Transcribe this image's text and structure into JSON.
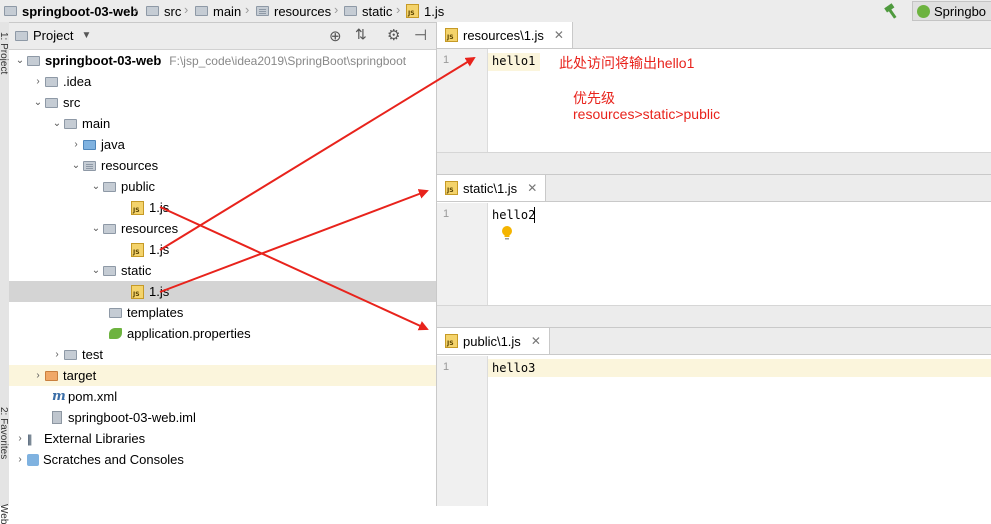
{
  "breadcrumb": {
    "items": [
      {
        "label": "springboot-03-web",
        "icon": "module-folder-icon"
      },
      {
        "label": "src",
        "icon": "folder-icon"
      },
      {
        "label": "main",
        "icon": "folder-icon"
      },
      {
        "label": "resources",
        "icon": "resources-folder-icon"
      },
      {
        "label": "static",
        "icon": "folder-icon"
      },
      {
        "label": "1.js",
        "icon": "js-file-icon"
      }
    ],
    "run_config": "Springbo",
    "build_icon": "hammer-icon"
  },
  "left_strip": {
    "project_label": "1: Project",
    "favorites_label": "2: Favorites",
    "web_label": "Web"
  },
  "project_panel": {
    "title": "Project",
    "tree": [
      {
        "label": "springboot-03-web",
        "path": "F:\\jsp_code\\idea2019\\SpringBoot\\springboot",
        "icon": "module-folder-icon"
      },
      {
        "label": ".idea",
        "icon": "folder-icon"
      },
      {
        "label": "src",
        "icon": "folder-icon"
      },
      {
        "label": "main",
        "icon": "folder-icon"
      },
      {
        "label": "java",
        "icon": "source-folder-icon"
      },
      {
        "label": "resources",
        "icon": "resources-folder-icon"
      },
      {
        "label": "public",
        "icon": "folder-icon"
      },
      {
        "label": "1.js",
        "icon": "js-file-icon"
      },
      {
        "label": "resources",
        "icon": "folder-icon"
      },
      {
        "label": "1.js",
        "icon": "js-file-icon"
      },
      {
        "label": "static",
        "icon": "folder-icon"
      },
      {
        "label": "1.js",
        "icon": "js-file-icon"
      },
      {
        "label": "templates",
        "icon": "folder-icon"
      },
      {
        "label": "application.properties",
        "icon": "spring-properties-icon"
      },
      {
        "label": "test",
        "icon": "folder-icon"
      },
      {
        "label": "target",
        "icon": "excluded-folder-icon"
      },
      {
        "label": "pom.xml",
        "icon": "maven-icon"
      },
      {
        "label": "springboot-03-web.iml",
        "icon": "iml-file-icon"
      },
      {
        "label": "External Libraries",
        "icon": "libraries-icon"
      },
      {
        "label": "Scratches and Consoles",
        "icon": "scratches-icon"
      }
    ]
  },
  "editors": [
    {
      "tab": "resources\\1.js",
      "line": "1",
      "code": "hello1"
    },
    {
      "tab": "static\\1.js",
      "line": "1",
      "code": "hello2"
    },
    {
      "tab": "public\\1.js",
      "line": "1",
      "code": "hello3"
    }
  ],
  "annotations": {
    "line1": "此处访问将输出hello1",
    "line2": "优先级",
    "line3": "resources>static>public",
    "color": "#e8231c"
  }
}
